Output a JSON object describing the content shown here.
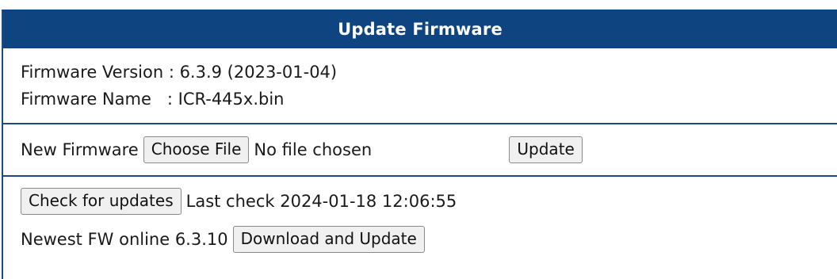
{
  "header": {
    "title": "Update Firmware"
  },
  "info": {
    "version_line": "Firmware Version : 6.3.9 (2023-01-04)",
    "name_line": "Firmware Name   : ICR-445x.bin"
  },
  "upload": {
    "label": "New Firmware",
    "choose_file_label": "Choose File",
    "file_status": "No file chosen",
    "update_label": "Update"
  },
  "online": {
    "check_label": "Check for updates",
    "last_check": "Last check 2024-01-18 12:06:55",
    "newest_label": "Newest FW online 6.3.10",
    "download_label": "Download and Update"
  },
  "colors": {
    "header_bg": "#0e4580",
    "header_text": "#ffffff",
    "divider": "#1f4a7a",
    "button_bg": "#f0f0f0"
  }
}
